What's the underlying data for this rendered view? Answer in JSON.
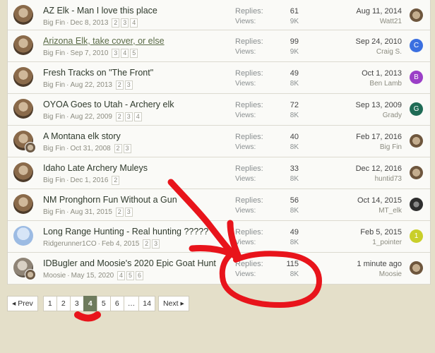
{
  "threads": [
    {
      "title": "AZ Elk - Man I love this place",
      "author": "Big Fin",
      "date": "Dec 8, 2013",
      "pages": [
        "2",
        "3",
        "4"
      ],
      "replies_label": "Replies:",
      "replies": "61",
      "views_label": "Views:",
      "views": "9K",
      "last_date": "Aug 11, 2014",
      "last_user": "Watt21",
      "last_avatar": "photo",
      "last_initial": "",
      "avatar": "bigfin"
    },
    {
      "title": "Arizona Elk, take cover, or else",
      "author": "Big Fin",
      "date": "Sep 7, 2010",
      "pages": [
        "3",
        "4",
        "5"
      ],
      "replies_label": "Replies:",
      "replies": "99",
      "views_label": "Views:",
      "views": "9K",
      "last_date": "Sep 24, 2010",
      "last_user": "Craig S.",
      "last_avatar": "letter",
      "last_initial": "C",
      "last_color": "#3b6fe0",
      "avatar": "bigfin",
      "visited": true
    },
    {
      "title": "Fresh Tracks on \"The Front\"",
      "author": "Big Fin",
      "date": "Aug 22, 2013",
      "pages": [
        "2",
        "3"
      ],
      "replies_label": "Replies:",
      "replies": "49",
      "views_label": "Views:",
      "views": "8K",
      "last_date": "Oct 1, 2013",
      "last_user": "Ben Lamb",
      "last_avatar": "letter",
      "last_initial": "B",
      "last_color": "#9b3fc7",
      "avatar": "bigfin"
    },
    {
      "title": "OYOA Goes to Utah - Archery elk",
      "author": "Big Fin",
      "date": "Aug 22, 2009",
      "pages": [
        "2",
        "3",
        "4"
      ],
      "replies_label": "Replies:",
      "replies": "72",
      "views_label": "Views:",
      "views": "8K",
      "last_date": "Sep 13, 2009",
      "last_user": "Grady",
      "last_avatar": "letter",
      "last_initial": "G",
      "last_color": "#1f6b55",
      "avatar": "bigfin"
    },
    {
      "title": "A Montana elk story",
      "author": "Big Fin",
      "date": "Oct 31, 2008",
      "pages": [
        "2",
        "3"
      ],
      "replies_label": "Replies:",
      "replies": "40",
      "views_label": "Views:",
      "views": "8K",
      "last_date": "Feb 17, 2016",
      "last_user": "Big Fin",
      "last_avatar": "photo",
      "last_initial": "",
      "avatar": "bigfin-mini"
    },
    {
      "title": "Idaho Late Archery Muleys",
      "author": "Big Fin",
      "date": "Dec 1, 2016",
      "pages": [
        "2"
      ],
      "replies_label": "Replies:",
      "replies": "33",
      "views_label": "Views:",
      "views": "8K",
      "last_date": "Dec 12, 2016",
      "last_user": "huntid73",
      "last_avatar": "photo",
      "last_initial": "",
      "avatar": "bigfin"
    },
    {
      "title": "NM Pronghorn Fun Without a Gun",
      "author": "Big Fin",
      "date": "Aug 31, 2015",
      "pages": [
        "2",
        "3"
      ],
      "replies_label": "Replies:",
      "replies": "56",
      "views_label": "Views:",
      "views": "8K",
      "last_date": "Oct 14, 2015",
      "last_user": "MT_elk",
      "last_avatar": "dark",
      "last_initial": "",
      "avatar": "bigfin"
    },
    {
      "title": "Long Range Hunting - Real hunting ?????",
      "author": "Ridgerunner1CO",
      "date": "Feb 4, 2015",
      "pages": [
        "2",
        "3"
      ],
      "replies_label": "Replies:",
      "replies": "49",
      "views_label": "Views:",
      "views": "8K",
      "last_date": "Feb 5, 2015",
      "last_user": "1_pointer",
      "last_avatar": "letter",
      "last_initial": "1",
      "last_color": "#c9cf2a",
      "avatar": "blue"
    },
    {
      "title": "IDBugler and Moosie's 2020 Epic Goat Hunt",
      "author": "Moosie",
      "date": "May 15, 2020",
      "pages": [
        "4",
        "5",
        "6"
      ],
      "replies_label": "Replies:",
      "replies": "115",
      "views_label": "Views:",
      "views": "8K",
      "last_date": "1 minute ago",
      "last_user": "Moosie",
      "last_avatar": "photo",
      "last_initial": "",
      "avatar": "moosie"
    }
  ],
  "pagination": {
    "prev_label": "◂ Prev",
    "next_label": "Next ▸",
    "pages": [
      "1",
      "2",
      "3",
      "4",
      "5",
      "6",
      "…",
      "14"
    ],
    "current": "4"
  },
  "annotation_color": "#e8141b"
}
